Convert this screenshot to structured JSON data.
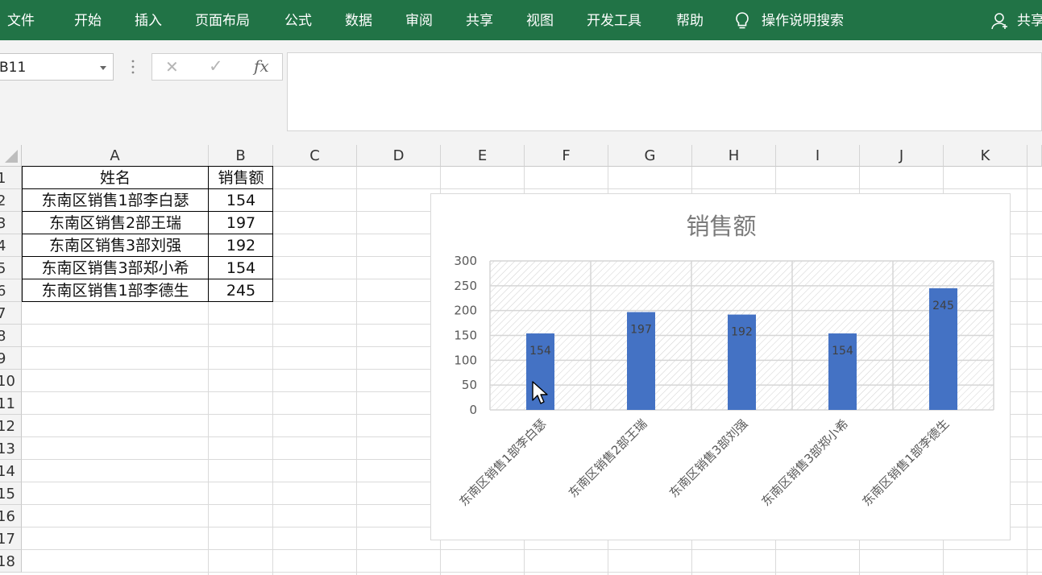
{
  "ribbon": {
    "tabs": [
      "文件",
      "开始",
      "插入",
      "页面布局",
      "公式",
      "数据",
      "审阅",
      "共享",
      "视图",
      "开发工具",
      "帮助"
    ],
    "tell_me": "操作说明搜索",
    "share": "共享"
  },
  "formula_bar": {
    "name_box": "B11",
    "cancel_glyph": "✕",
    "enter_glyph": "✓",
    "fx_label": "fx",
    "formula": ""
  },
  "sheet": {
    "columns": [
      "A",
      "B",
      "C",
      "D",
      "E",
      "F",
      "G",
      "H",
      "I",
      "J",
      "K"
    ],
    "rows": [
      "1",
      "2",
      "3",
      "4",
      "5",
      "6",
      "7",
      "8",
      "9",
      "10",
      "11",
      "12",
      "13",
      "14",
      "15",
      "16",
      "17",
      "18"
    ],
    "header": {
      "a": "姓名",
      "b": "销售额"
    },
    "data": [
      {
        "a": "东南区销售1部李白瑟",
        "b": "154"
      },
      {
        "a": "东南区销售2部王瑞",
        "b": "197"
      },
      {
        "a": "东南区销售3部刘强",
        "b": "192"
      },
      {
        "a": "东南区销售3部郑小希",
        "b": "154"
      },
      {
        "a": "东南区销售1部李德生",
        "b": "245"
      }
    ]
  },
  "chart_data": {
    "type": "bar",
    "title": "销售额",
    "categories": [
      "东南区销售1部李白瑟",
      "东南区销售2部王瑞",
      "东南区销售3部刘强",
      "东南区销售3部郑小希",
      "东南区销售1部李德生"
    ],
    "values": [
      154,
      197,
      192,
      154,
      245
    ],
    "ylim": [
      0,
      300
    ],
    "yticks": [
      0,
      50,
      100,
      150,
      200,
      250,
      300
    ],
    "grid": true,
    "data_labels": true,
    "bar_color": "#4472C4",
    "plot_fill": "hatched"
  },
  "colors": {
    "ribbon": "#217346",
    "bar": "#4472C4"
  }
}
